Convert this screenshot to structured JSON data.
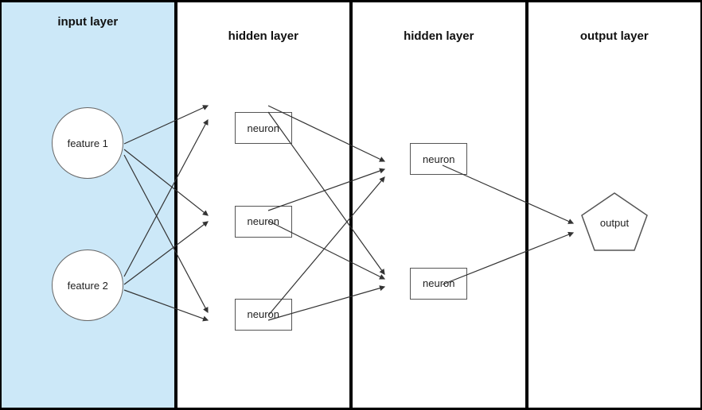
{
  "layers": [
    {
      "id": "input-layer",
      "title": "input layer",
      "type": "input",
      "nodes": [
        {
          "label": "feature 1",
          "shape": "circle"
        },
        {
          "label": "feature 2",
          "shape": "circle"
        }
      ]
    },
    {
      "id": "hidden-layer-1",
      "title": "hidden layer",
      "type": "hidden",
      "nodes": [
        {
          "label": "neuron",
          "shape": "rect"
        },
        {
          "label": "neuron",
          "shape": "rect"
        },
        {
          "label": "neuron",
          "shape": "rect"
        }
      ]
    },
    {
      "id": "hidden-layer-2",
      "title": "hidden layer",
      "type": "hidden",
      "nodes": [
        {
          "label": "neuron",
          "shape": "rect"
        },
        {
          "label": "neuron",
          "shape": "rect"
        }
      ]
    },
    {
      "id": "output-layer",
      "title": "output layer",
      "type": "output",
      "nodes": [
        {
          "label": "output",
          "shape": "pentagon"
        }
      ]
    }
  ],
  "colors": {
    "input_bg": "#cce8f8",
    "default_bg": "#ffffff",
    "black_bg": "#000000",
    "border": "#555555"
  }
}
